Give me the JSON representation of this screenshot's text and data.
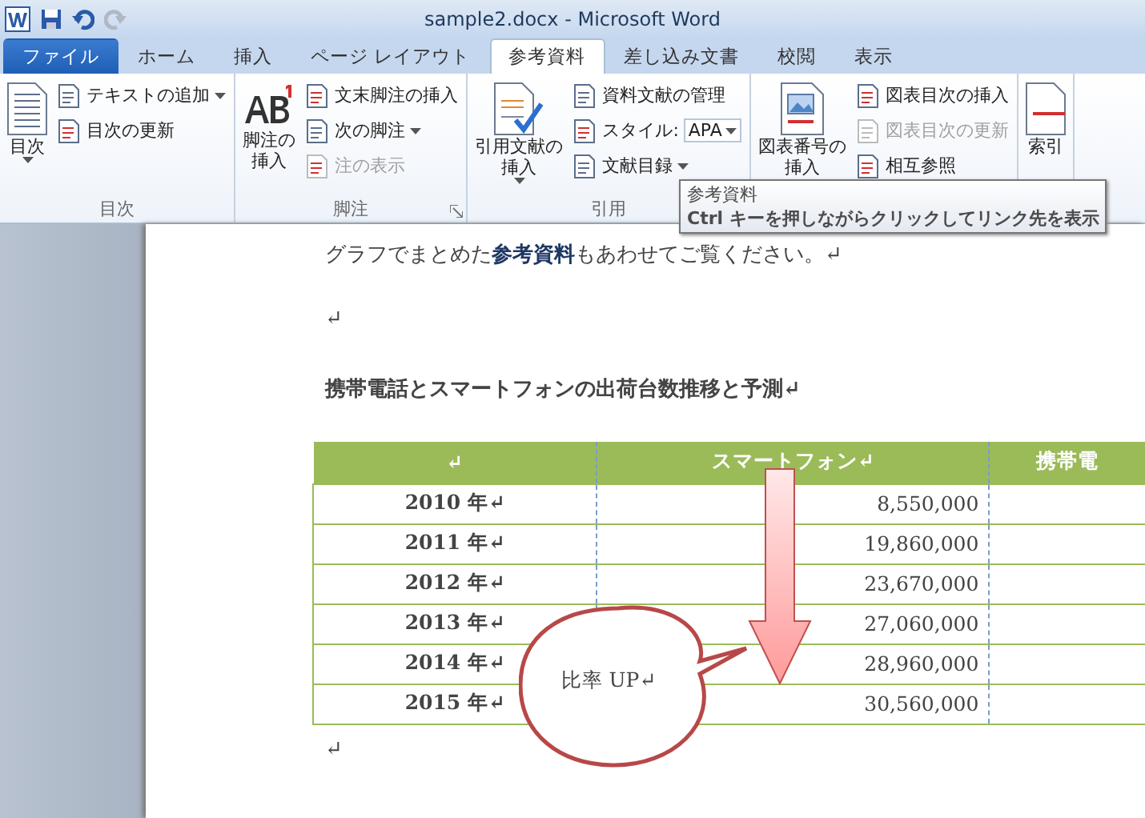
{
  "window": {
    "title": "sample2.docx - Microsoft Word"
  },
  "quick_access": [
    {
      "kind": "save"
    },
    {
      "kind": "undo"
    },
    {
      "kind": "redo",
      "disabled": true
    }
  ],
  "tabs": [
    {
      "label": "ファイル",
      "kind": "file",
      "selected": false
    },
    {
      "label": "ホーム",
      "kind": "tab",
      "selected": false
    },
    {
      "label": "挿入",
      "kind": "tab",
      "selected": false
    },
    {
      "label": "ページ レイアウト",
      "kind": "tab",
      "selected": false
    },
    {
      "label": "参考資料",
      "kind": "tab",
      "selected": true
    },
    {
      "label": "差し込み文書",
      "kind": "tab",
      "selected": false
    },
    {
      "label": "校閲",
      "kind": "tab",
      "selected": false
    },
    {
      "label": "表示",
      "kind": "tab",
      "selected": false
    }
  ],
  "ribbon": {
    "groups": [
      {
        "label": "目次",
        "launcher": false,
        "large": {
          "label": "目次",
          "caret": true,
          "kind": "toc"
        },
        "small": [
          {
            "label": "テキストの追加",
            "kind": "button",
            "caret": true,
            "disabled": false
          },
          {
            "label": "目次の更新",
            "kind": "button",
            "caret": false,
            "disabled": false
          }
        ]
      },
      {
        "label": "脚注",
        "launcher": true,
        "large": {
          "label": "脚注の挿入",
          "caret": false,
          "kind": "footnote"
        },
        "small": [
          {
            "label": "文末脚注の挿入",
            "kind": "button",
            "caret": false,
            "disabled": false
          },
          {
            "label": "次の脚注",
            "kind": "button",
            "caret": true,
            "disabled": false
          },
          {
            "label": "注の表示",
            "kind": "button",
            "caret": false,
            "disabled": true
          }
        ]
      },
      {
        "label": "引用",
        "large": {
          "label": "引用文献の挿入",
          "caret": true,
          "kind": "citation"
        },
        "small": [
          {
            "label": "資料文献の管理",
            "kind": "button",
            "caret": false,
            "disabled": false
          },
          {
            "label": "スタイル:",
            "kind": "select",
            "value": "APA",
            "caret": true,
            "disabled": false
          },
          {
            "label": "文献目録",
            "kind": "button",
            "caret": true,
            "disabled": false
          }
        ]
      },
      {
        "large": {
          "label": "図表番号の挿入",
          "caret": false,
          "kind": "caption"
        },
        "small": [
          {
            "label": "図表目次の挿入",
            "kind": "button",
            "caret": false,
            "disabled": false
          },
          {
            "label": "図表目次の更新",
            "kind": "button",
            "caret": false,
            "disabled": true
          },
          {
            "label": "相互参照",
            "kind": "button",
            "caret": false,
            "disabled": false
          }
        ]
      },
      {
        "large": {
          "label": "索引",
          "caret": false,
          "kind": "index"
        }
      }
    ]
  },
  "tooltip": {
    "title": "参考資料",
    "text": "Ctrl キーを押しながらクリックしてリンク先を表示"
  },
  "document": {
    "paragraphs": [
      {
        "kind": "text",
        "text": "グラフでまとめた**参考資料**もあわせてご覧ください。↵"
      },
      {
        "kind": "text",
        "text": "↵"
      },
      {
        "kind": "heading",
        "text": "携帯電話とスマートフォンの出荷台数推移と予測↵"
      }
    ],
    "table": {
      "columns": [
        "↵",
        "スマートフォン↵",
        "携帯電"
      ],
      "rows": [
        [
          "2010 年↵",
          "8,550,000",
          ""
        ],
        [
          "2011 年↵",
          "19,860,000",
          ""
        ],
        [
          "2012 年↵",
          "23,670,000",
          ""
        ],
        [
          "2013 年↵",
          "27,060,000",
          ""
        ],
        [
          "2014 年↵",
          "28,960,000",
          ""
        ],
        [
          "2015 年↵",
          "30,560,000",
          ""
        ]
      ]
    },
    "after": "↵",
    "callout": "比率 UP↵"
  }
}
